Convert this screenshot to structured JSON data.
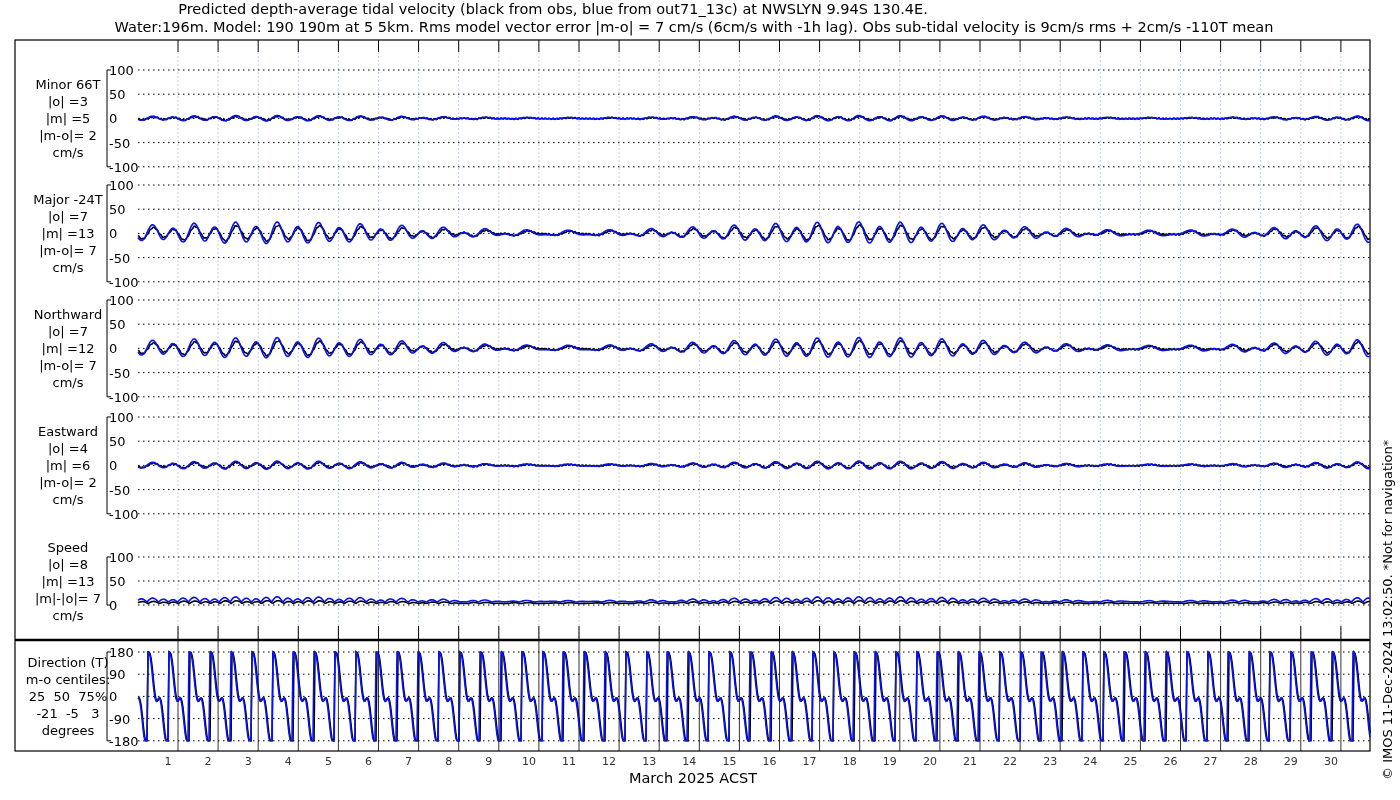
{
  "title_lines": [
    "Predicted depth-average tidal velocity (black from obs, blue from out71_13c) at NWSLYN 9.94S 130.4E.",
    "Water:196m. Model: 190 190m at 5 5km. Rms model vector error |m-o| = 7 cm/s (6cm/s with -1h lag). Obs sub-tidal velocity is 9cm/s rms + 2cm/s -110T mean"
  ],
  "panels": [
    {
      "kind": "velocity",
      "labels": [
        "Minor 66T",
        "|o| =3",
        "|m| =5",
        "|m-o|= 2",
        "cm/s"
      ],
      "yticks": [
        "100",
        "50",
        "0",
        "-50",
        "-100"
      ]
    },
    {
      "kind": "velocity",
      "labels": [
        "Major -24T",
        "|o| =7",
        "|m| =13",
        "|m-o|= 7",
        "cm/s"
      ],
      "yticks": [
        "100",
        "50",
        "0",
        "-50",
        "-100"
      ]
    },
    {
      "kind": "velocity",
      "labels": [
        "Northward",
        "|o| =7",
        "|m| =12",
        "|m-o|= 7",
        "cm/s"
      ],
      "yticks": [
        "100",
        "50",
        "0",
        "-50",
        "-100"
      ]
    },
    {
      "kind": "velocity",
      "labels": [
        "Eastward",
        "|o| =4",
        "|m| =6",
        "|m-o|= 2",
        "cm/s"
      ],
      "yticks": [
        "100",
        "50",
        "0",
        "-50",
        "-100"
      ]
    },
    {
      "kind": "speed",
      "labels": [
        "Speed",
        "|o| =8",
        "|m| =13",
        "|m|-|o|= 7",
        "cm/s"
      ],
      "yticks": [
        "100",
        "50",
        "0"
      ]
    },
    {
      "kind": "direction",
      "labels": [
        "Direction (T)",
        "m-o centiles:",
        "25  50  75%",
        "-21  -5   3",
        "degrees"
      ],
      "yticks": [
        "180",
        "90",
        "0",
        "-90",
        "-180"
      ]
    }
  ],
  "x_axis": {
    "ticks": [
      "1",
      "2",
      "3",
      "4",
      "5",
      "6",
      "7",
      "8",
      "9",
      "10",
      "11",
      "12",
      "13",
      "14",
      "15",
      "16",
      "17",
      "18",
      "19",
      "20",
      "21",
      "22",
      "23",
      "24",
      "25",
      "26",
      "27",
      "28",
      "29",
      "30"
    ],
    "label": "March 2025 ACST"
  },
  "side_note": "© IMOS 11-Dec-2024 13:02:50. *Not for navigation*"
}
